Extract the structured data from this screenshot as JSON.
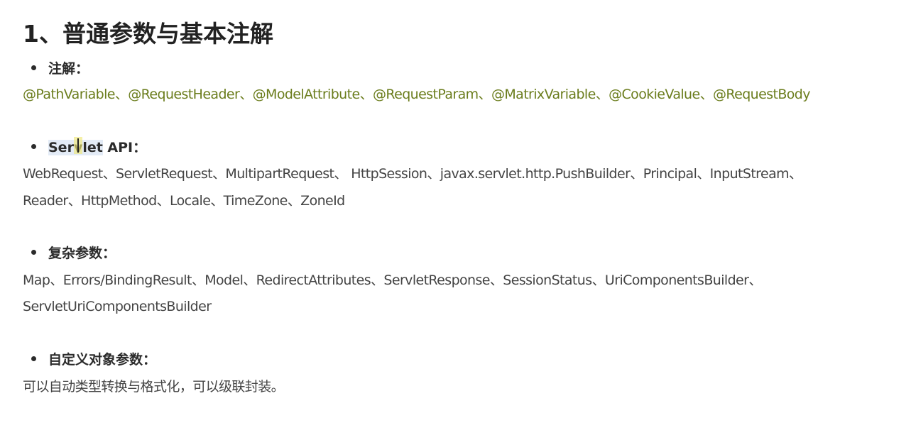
{
  "title": "1、普通参数与基本注解",
  "sections": [
    {
      "heading": "注解：",
      "lines": [
        "@PathVariable、@RequestHeader、@ModelAttribute、@RequestParam、@MatrixVariable、@CookieValue、@RequestBody"
      ]
    },
    {
      "heading_highlight": "Servlet",
      "heading_rest": " API：",
      "lines": [
        "WebRequest、ServletRequest、MultipartRequest、 HttpSession、javax.servlet.http.PushBuilder、Principal、InputStream、",
        "Reader、HttpMethod、Locale、TimeZone、ZoneId"
      ]
    },
    {
      "heading": "复杂参数：",
      "lines": [
        "Map、Errors/BindingResult、Model、RedirectAttributes、ServletResponse、SessionStatus、UriComponentsBuilder、",
        "ServletUriComponentsBuilder"
      ]
    },
    {
      "heading": "自定义对象参数：",
      "lines": [
        "可以自动类型转换与格式化，可以级联封装。"
      ]
    }
  ],
  "colors": {
    "annotation_text": "#6b7d1d",
    "body_text": "#444444",
    "heading_text": "#2b2b2b",
    "selection_highlight": "#e3ebf6"
  }
}
